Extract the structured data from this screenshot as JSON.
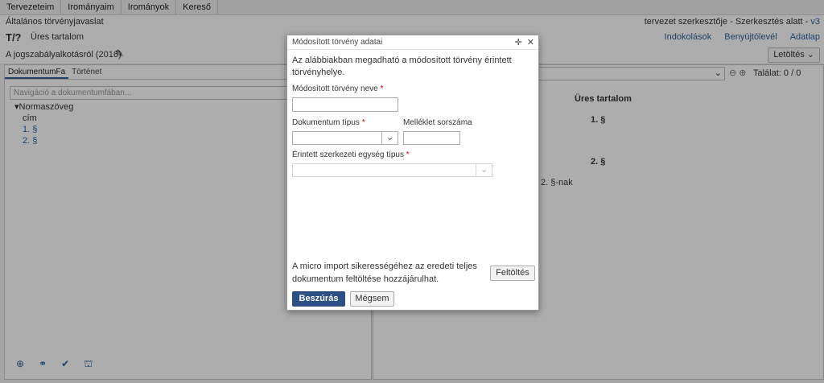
{
  "menu": [
    "Tervezeteim",
    "Irományaim",
    "Irományok",
    "Kereső"
  ],
  "header": {
    "doc_type": "Általános törvényjavaslat",
    "editor_status": "tervezet szerkesztője - Szerkesztés alatt - ",
    "version": "v3",
    "t_number": "T/?",
    "t_name": "Üres tartalom",
    "links": [
      "Indokolások",
      "Benyújtólevél",
      "Adatlap"
    ],
    "law_title": "A jogszabályalkotásról (2016)",
    "download_label": "Letöltés"
  },
  "left_panel": {
    "tabs": [
      "DokumentumFa",
      "Történet"
    ],
    "nav_placeholder": "Navigáció a dokumentumfában...",
    "tree_root": "Normaszöveg",
    "tree_items": [
      "cím",
      "1. §",
      "2. §"
    ]
  },
  "right_panel": {
    "found": "Találat: 0 / 0",
    "title": "Üres tartalom",
    "sec1": "1. §",
    "sec2": "2. §",
    "nak": "2. §-nak"
  },
  "modal": {
    "title": "Módosított törvény adatai",
    "intro": "Az alábbiakban megadható a módosított törvény érintett törvényhelye.",
    "law_name_label": "Módosított törvény neve",
    "law_name_value": "",
    "doc_type_label": "Dokumentum típus",
    "doc_type_value": "",
    "annex_label": "Melléklet sorszáma",
    "annex_value": "",
    "unit_type_label": "Érintett szerkezeti egység típus",
    "unit_type_value": "",
    "required_mark": "*",
    "note": "A micro import sikerességéhez az eredeti teljes dokumentum feltöltése hozzájárulhat.",
    "upload_label": "Feltöltés",
    "insert_label": "Beszúrás",
    "cancel_label": "Mégsem"
  }
}
